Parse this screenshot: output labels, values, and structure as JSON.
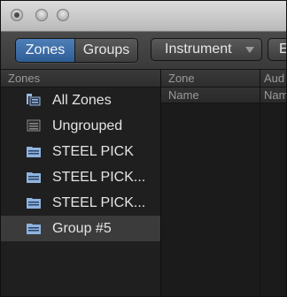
{
  "toolbar": {
    "segment": {
      "zones_label": "Zones",
      "groups_label": "Groups",
      "selected": "Zones"
    },
    "dropdown_label": "Instrument",
    "partial_button_label": "E"
  },
  "zones_pane": {
    "header": "Zones",
    "items": [
      {
        "label": "All Zones",
        "icon": "all-zones-icon"
      },
      {
        "label": "Ungrouped",
        "icon": "ungrouped-icon"
      },
      {
        "label": "STEEL PICK",
        "icon": "folder-icon"
      },
      {
        "label": "STEEL PICK...",
        "icon": "folder-icon"
      },
      {
        "label": "STEEL PICK...",
        "icon": "folder-icon"
      },
      {
        "label": "Group #5",
        "icon": "folder-icon",
        "selected": true
      }
    ]
  },
  "table": {
    "group_headers": [
      "Zone",
      "Aud"
    ],
    "column_headers": [
      "Name",
      "Nam"
    ]
  },
  "colors": {
    "accent": "#3c6ca6",
    "folder_icon": "#8fb3df"
  }
}
